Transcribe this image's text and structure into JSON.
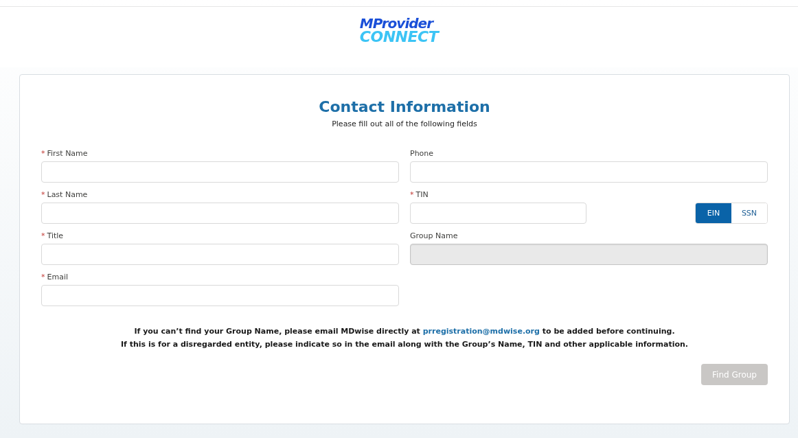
{
  "logo": {
    "line_1": "MProvider",
    "line_2": "CONNECT"
  },
  "form": {
    "required_marker": "*",
    "title": "Contact Information",
    "subtitle": "Please fill out all of the following fields",
    "left_fields": [
      {
        "label": "First Name",
        "required": true,
        "disabled": false
      },
      {
        "label": "Last Name",
        "required": true,
        "disabled": false
      },
      {
        "label": "Title",
        "required": true,
        "disabled": false
      },
      {
        "label": "Email",
        "required": true,
        "disabled": false
      }
    ],
    "right_fields": [
      {
        "label": "Phone",
        "required": false,
        "disabled": false,
        "kind": "text"
      },
      {
        "label": "TIN",
        "required": true,
        "disabled": false,
        "kind": "tin"
      },
      {
        "label": "Group Name",
        "required": false,
        "disabled": true,
        "kind": "text"
      }
    ],
    "tin_type": [
      {
        "label": "EIN",
        "selected": true
      },
      {
        "label": "SSN",
        "selected": false
      }
    ],
    "notice": {
      "line_1_before": "If you can’t find your Group Name, please email MDwise directly at",
      "link": "prregistration@mdwise.org",
      "line_1_after": "to be added before continuing.",
      "line_2": "If this is for a disregarded entity, please indicate so in the email along with the Group’s Name, TIN and other applicable information."
    },
    "find_button": {
      "label": "Find Group",
      "disabled": true
    }
  }
}
